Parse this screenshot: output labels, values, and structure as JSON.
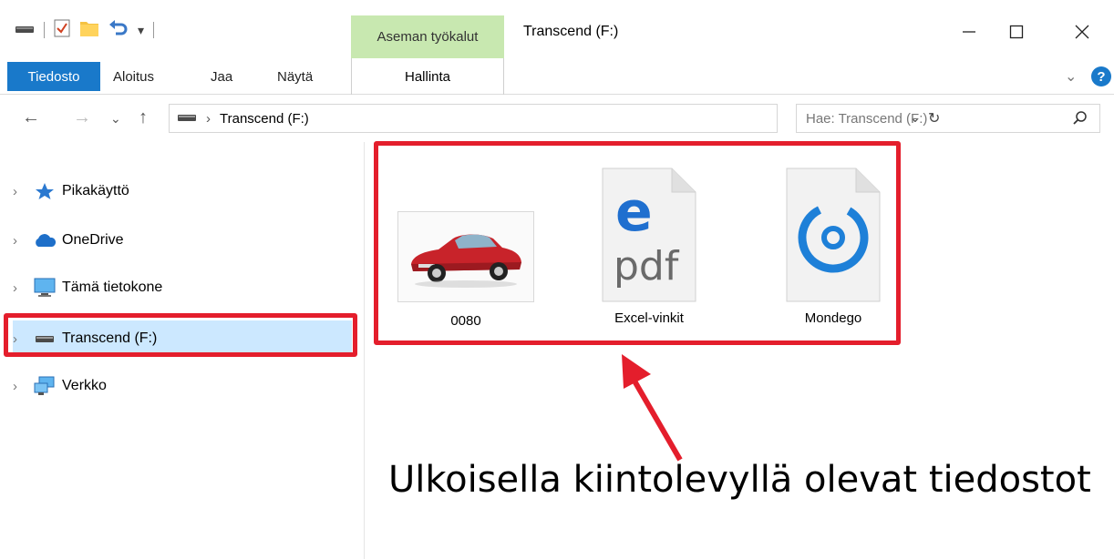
{
  "window": {
    "title": "Transcend (F:)",
    "contextual_tab_group": "Aseman työkalut"
  },
  "ribbon": {
    "tabs": [
      {
        "label": "Tiedosto"
      },
      {
        "label": "Aloitus"
      },
      {
        "label": "Jaa"
      },
      {
        "label": "Näytä"
      },
      {
        "label": "Hallinta"
      }
    ]
  },
  "address": {
    "path": "Transcend (F:)",
    "search_placeholder": "Hae: Transcend (F:)"
  },
  "navigation": {
    "items": [
      {
        "label": "Pikakäyttö",
        "icon": "star-icon"
      },
      {
        "label": "OneDrive",
        "icon": "cloud-icon"
      },
      {
        "label": "Tämä tietokone",
        "icon": "computer-icon"
      },
      {
        "label": "Transcend (F:)",
        "icon": "drive-icon",
        "selected": true
      },
      {
        "label": "Verkko",
        "icon": "network-icon"
      }
    ]
  },
  "files": [
    {
      "name": "0080",
      "type": "image"
    },
    {
      "name": "Excel-vinkit",
      "type": "pdf"
    },
    {
      "name": "Mondego",
      "type": "groove"
    }
  ],
  "annotation": {
    "text": "Ulkoisella kiintolevyllä olevat tiedostot"
  },
  "colors": {
    "accent": "#1979ca",
    "highlight": "#e41e2c",
    "selection": "#cce8ff",
    "contextual": "#c8e8b0"
  }
}
